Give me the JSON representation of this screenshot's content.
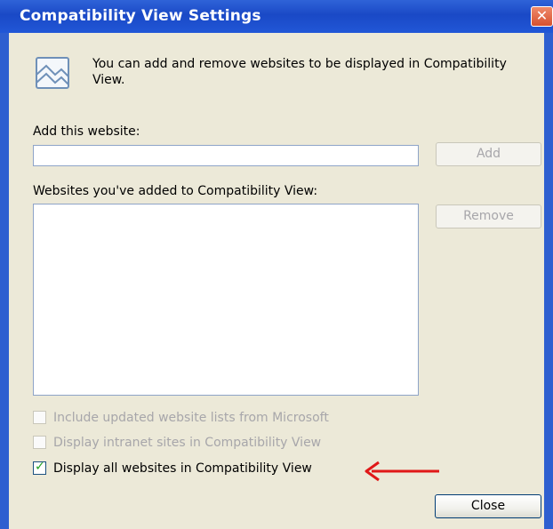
{
  "window": {
    "title": "Compatibility View Settings",
    "close_glyph": "✕",
    "titlebar_color": "#2157d7",
    "accent_color": "#e03a16"
  },
  "info": {
    "text": "You can add and remove websites to be displayed in Compatibility View.",
    "icon": "compatibility-view-icon"
  },
  "add_section": {
    "label": "Add this website:",
    "input_value": "",
    "add_button": "Add"
  },
  "list_section": {
    "label": "Websites you've added to Compatibility View:",
    "items": [],
    "remove_button": "Remove"
  },
  "options": [
    {
      "label": "Include updated website lists from Microsoft",
      "checked": false,
      "enabled": false
    },
    {
      "label": "Display intranet sites in Compatibility View",
      "checked": false,
      "enabled": false
    },
    {
      "label": "Display all websites in Compatibility View",
      "checked": true,
      "enabled": true
    }
  ],
  "annotation": {
    "icon": "red-arrow-icon",
    "color": "#e01818"
  },
  "footer": {
    "close_button": "Close"
  }
}
